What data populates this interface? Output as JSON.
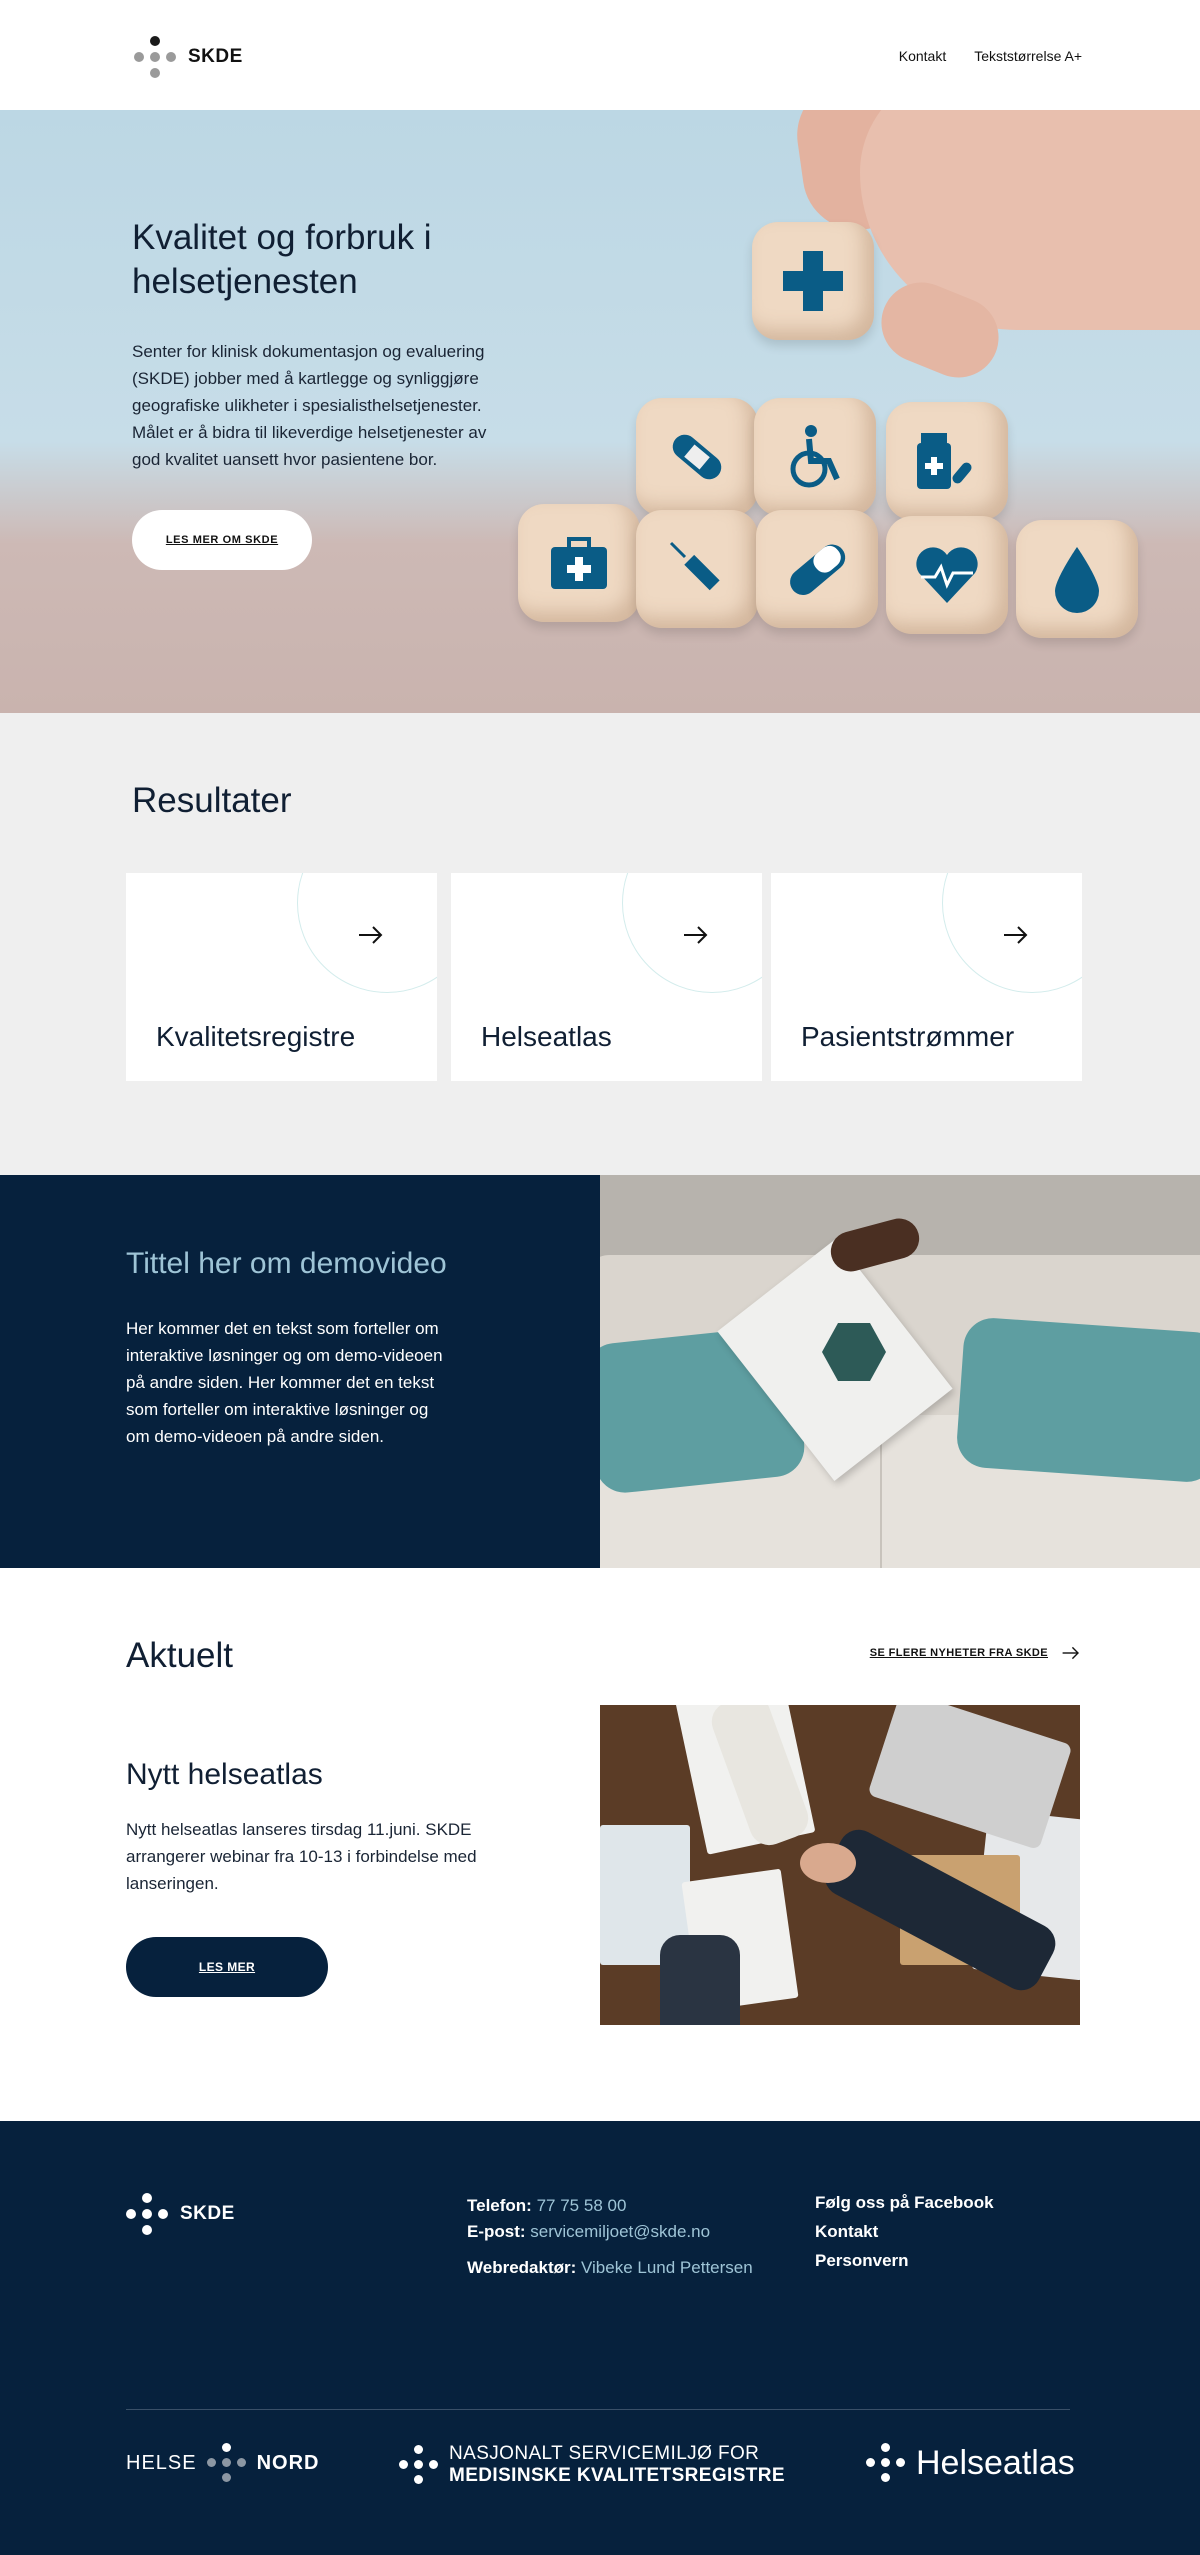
{
  "header": {
    "logo_text": "SKDE",
    "nav": {
      "contact": "Kontakt",
      "text_size": "Tekststørrelse A+"
    }
  },
  "hero": {
    "title": "Kvalitet og forbruk i helsetjenesten",
    "text": "Senter for klinisk dokumentasjon og evaluering (SKDE) jobber med å kartlegge og synliggjøre geografiske ulikheter i spesialisthelsetjenester. Målet er å bidra til likeverdige helsetjenester av god kvalitet uansett hvor pasientene bor.",
    "button": "LES MER OM SKDE",
    "image_icons": [
      "plus-icon",
      "bandage-icon",
      "wheelchair-icon",
      "medicine-icon",
      "first-aid-kit-icon",
      "syringe-icon",
      "pill-icon",
      "heart-pulse-icon",
      "drop-icon"
    ]
  },
  "results": {
    "title": "Resultater",
    "cards": [
      {
        "label": "Kvalitetsregistre"
      },
      {
        "label": "Helseatlas"
      },
      {
        "label": "Pasientstrømmer"
      }
    ]
  },
  "demo": {
    "title": "Tittel her om demovideo",
    "text": "Her kommer det en tekst som forteller om interaktive løsninger og om demo-videoen på andre siden. Her kommer det en tekst som forteller om interaktive løsninger og om demo-videoen på andre siden."
  },
  "news": {
    "title": "Aktuelt",
    "more_link": "SE FLERE NYHETER FRA SKDE",
    "article_title": "Nytt helseatlas",
    "article_text": "Nytt helseatlas lanseres tirsdag 11.juni. SKDE arrangerer webinar fra 10-13 i forbindelse med lanseringen.",
    "button": "LES MER"
  },
  "footer": {
    "logo_text": "SKDE",
    "phone_label": "Telefon:",
    "phone": "77 75 58 00",
    "email_label": "E-post:",
    "email": "servicemiljoet@skde.no",
    "editor_label": "Webredaktør:",
    "editor": "Vibeke Lund Pettersen",
    "links": [
      "Følg oss på Facebook",
      "Kontakt",
      "Personvern"
    ],
    "partners": {
      "helse_left": "HELSE",
      "helse_right": "NORD",
      "nasj_line1": "NASJONALT SERVICEMILJØ FOR",
      "nasj_line2": "MEDISINSKE KVALITETSREGISTRE",
      "atlas": "Helseatlas"
    }
  },
  "colors": {
    "navy": "#06213d",
    "light_blue_text": "#9ec4d6",
    "icon_blue": "#0a5c86",
    "grey_bg": "#efefef"
  }
}
